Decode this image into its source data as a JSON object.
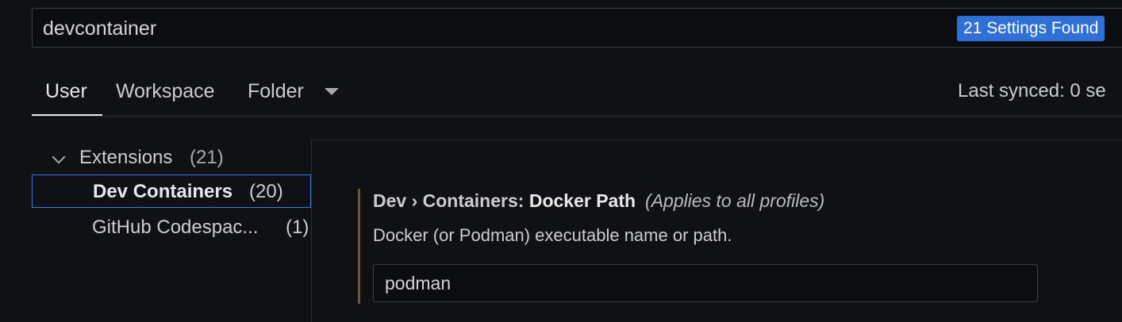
{
  "search": {
    "value": "devcontainer",
    "results_badge": "21 Settings Found"
  },
  "tabs": [
    {
      "label": "User",
      "active": true
    },
    {
      "label": "Workspace",
      "active": false
    },
    {
      "label": "Folder",
      "active": false
    }
  ],
  "sync": {
    "status": "Last synced: 0 se"
  },
  "tree": {
    "extensions": {
      "label": "Extensions",
      "count": "(21)"
    },
    "items": [
      {
        "label": "Dev Containers",
        "count": "(20)",
        "selected": true
      },
      {
        "label": "GitHub Codespac...",
        "count": "(1)",
        "selected": false
      }
    ]
  },
  "setting": {
    "category": "Dev › Containers: ",
    "name": "Docker Path",
    "scope": "(Applies to all profiles)",
    "description": "Docker (or Podman) executable name or path.",
    "value": "podman"
  },
  "colors": {
    "accent": "#2f6fd6",
    "selection_border": "#3b78e7",
    "modified_indicator": "#6b5a3a",
    "background": "#0f1115"
  },
  "icons": {
    "folder_dropdown": "chevron-down-icon",
    "tree_toggle": "chevron-down-icon"
  }
}
